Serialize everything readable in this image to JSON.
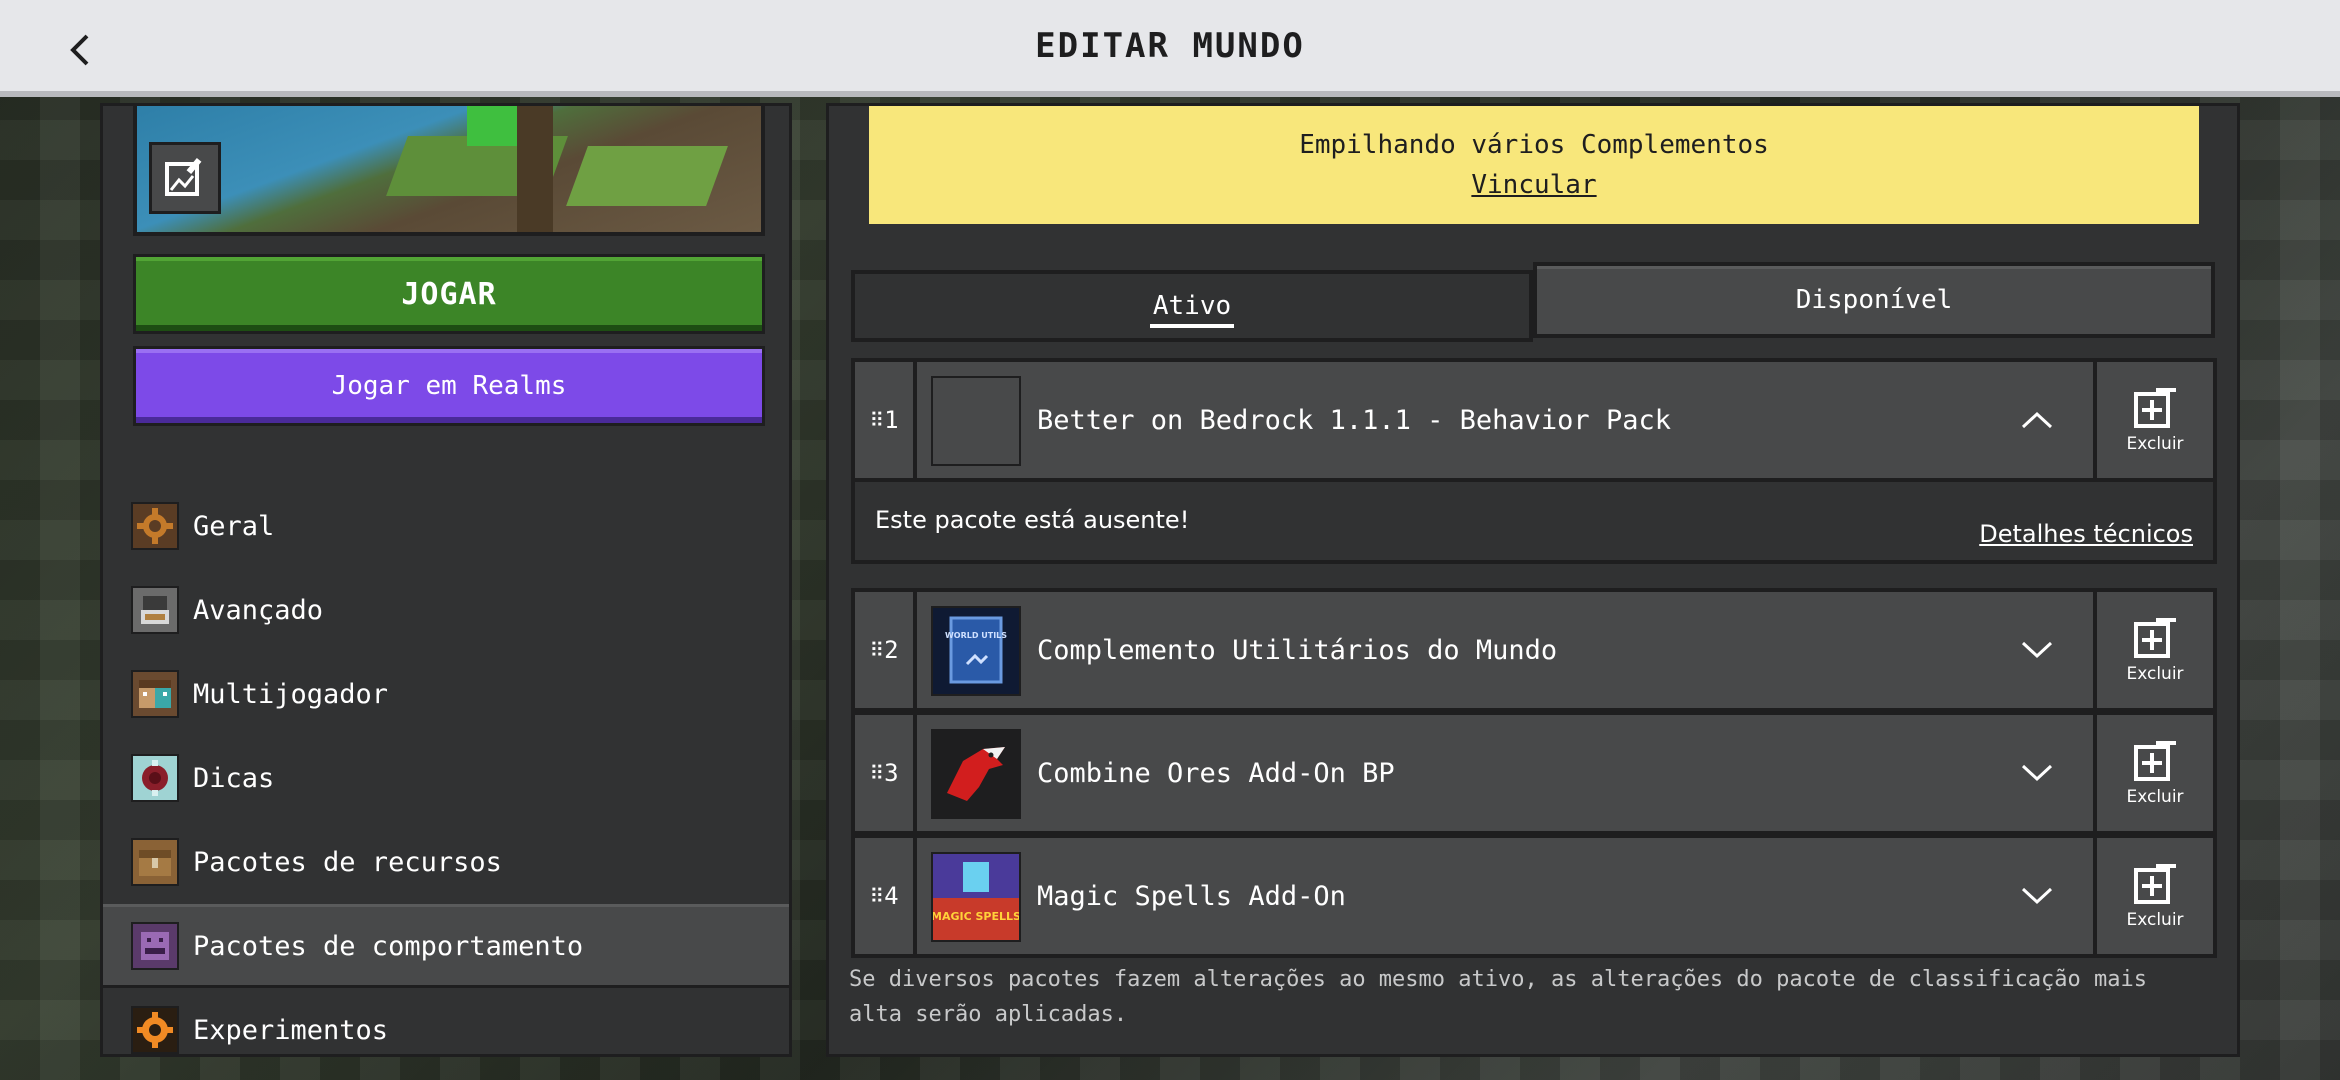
{
  "header": {
    "title": "EDITAR MUNDO",
    "back_icon": "chevron-left-icon"
  },
  "left": {
    "play_label": "JOGAR",
    "realms_label": "Jogar em Realms",
    "nav": [
      {
        "label": "Geral",
        "icon": "gear-icon"
      },
      {
        "label": "Avançado",
        "icon": "advanced-icon"
      },
      {
        "label": "Multijogador",
        "icon": "players-icon"
      },
      {
        "label": "Dicas",
        "icon": "tips-icon"
      },
      {
        "label": "Pacotes de recursos",
        "icon": "resource-pack-icon"
      },
      {
        "label": "Pacotes de comportamento",
        "icon": "behavior-pack-icon",
        "active": true
      },
      {
        "label": "Experimentos",
        "icon": "experiments-icon"
      }
    ]
  },
  "right": {
    "notice": {
      "text": "Empilhando vários Complementos",
      "link": "Vincular"
    },
    "tabs": {
      "active": "Ativo",
      "available": "Disponível"
    },
    "packs": [
      {
        "index": "1",
        "name": "Better on Bedrock 1.1.1 - Behavior Pack",
        "remove_label": "Excluir",
        "expanded": true,
        "missing_text": "Este pacote está ausente!",
        "details_link": "Detalhes técnicos"
      },
      {
        "index": "2",
        "name": "Complemento Utilitários do Mundo",
        "remove_label": "Excluir",
        "icon_text": "WORLD UTILS"
      },
      {
        "index": "3",
        "name": "Combine Ores Add-On BP",
        "remove_label": "Excluir"
      },
      {
        "index": "4",
        "name": "Magic Spells Add-On",
        "remove_label": "Excluir",
        "icon_text": "MAGIC SPELLS"
      }
    ],
    "footer": "Se diversos pacotes fazem alterações ao mesmo ativo, as alterações do pacote de classificação mais alta serão aplicadas."
  },
  "colors": {
    "play": "#3c8527",
    "realms": "#7d4ae8",
    "notice": "#f8e77b",
    "panel": "#313233"
  }
}
